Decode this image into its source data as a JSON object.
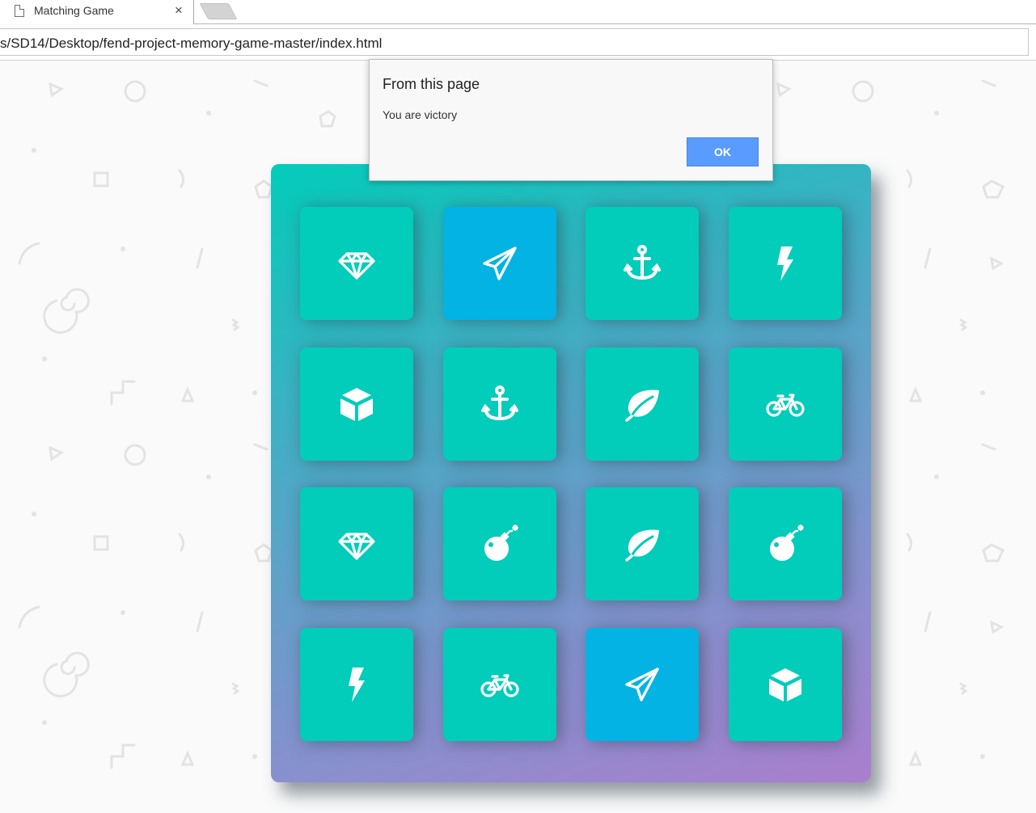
{
  "browser": {
    "tab_title": "Matching Game",
    "tab_close_glyph": "×",
    "address": "s/SD14/Desktop/fend-project-memory-game-master/index.html"
  },
  "dialog": {
    "title": "From this page",
    "message": "You are victory",
    "ok_label": "OK"
  },
  "colors": {
    "card_closed": "#02ccba",
    "card_open": "#02b3e4",
    "deck_gradient_start": "#02ccba",
    "deck_gradient_end": "#aa7ecd",
    "dialog_button": "#5a9bff"
  },
  "deck": {
    "cards": [
      {
        "icon": "diamond-icon",
        "state": "match"
      },
      {
        "icon": "paper-plane-icon",
        "state": "open"
      },
      {
        "icon": "anchor-icon",
        "state": "match"
      },
      {
        "icon": "bolt-icon",
        "state": "match"
      },
      {
        "icon": "cube-icon",
        "state": "match"
      },
      {
        "icon": "anchor-icon",
        "state": "match"
      },
      {
        "icon": "leaf-icon",
        "state": "match"
      },
      {
        "icon": "bicycle-icon",
        "state": "match"
      },
      {
        "icon": "diamond-icon",
        "state": "match"
      },
      {
        "icon": "bomb-icon",
        "state": "match"
      },
      {
        "icon": "leaf-icon",
        "state": "match"
      },
      {
        "icon": "bomb-icon",
        "state": "match"
      },
      {
        "icon": "bolt-icon",
        "state": "match"
      },
      {
        "icon": "bicycle-icon",
        "state": "match"
      },
      {
        "icon": "paper-plane-icon",
        "state": "open"
      },
      {
        "icon": "cube-icon",
        "state": "match"
      }
    ]
  }
}
